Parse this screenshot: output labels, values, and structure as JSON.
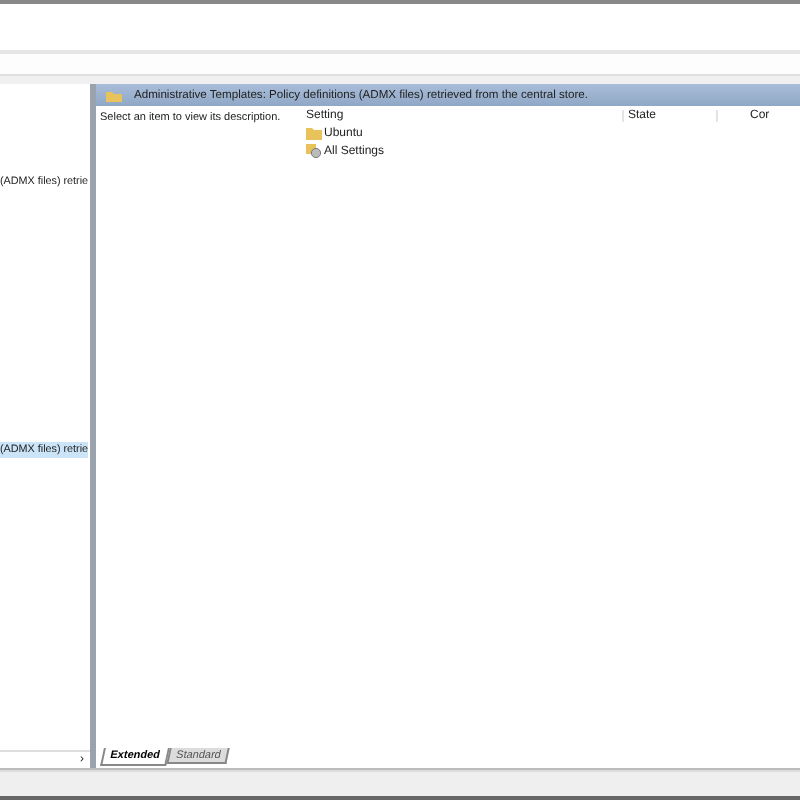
{
  "left_pane": {
    "items": [
      {
        "label": "(ADMX files) retrie",
        "selected": false
      },
      {
        "label": "(ADMX files) retrie",
        "selected": true
      }
    ],
    "scroll_arrow": "›"
  },
  "header": {
    "title": "Administrative Templates: Policy definitions (ADMX files) retrieved from the central store."
  },
  "description": "Select an item to view its description.",
  "table": {
    "columns": [
      "Setting",
      "State",
      "Cor"
    ],
    "rows": [
      {
        "kind": "folder",
        "label": "Ubuntu"
      },
      {
        "kind": "settings",
        "label": "All Settings"
      }
    ]
  },
  "tabs": [
    {
      "label": "Extended",
      "selected": true
    },
    {
      "label": "Standard",
      "selected": false
    }
  ]
}
